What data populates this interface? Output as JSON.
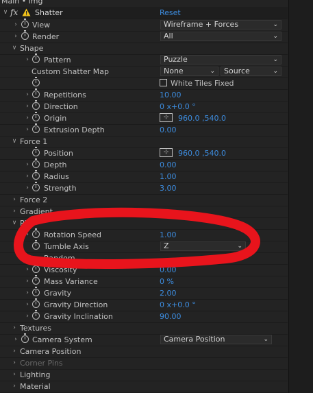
{
  "breadcrumb": "Main • img",
  "effect": {
    "name": "Shatter",
    "reset_label": "Reset",
    "fx_label": "fx"
  },
  "view": {
    "label": "View",
    "value": "Wireframe + Forces"
  },
  "render": {
    "label": "Render",
    "value": "All"
  },
  "shape": {
    "label": "Shape",
    "pattern": {
      "label": "Pattern",
      "value": "Puzzle"
    },
    "custom_map": {
      "label": "Custom Shatter Map",
      "value": "None",
      "source": "Source"
    },
    "white_tiles": {
      "label": "White Tiles Fixed",
      "checked": false
    },
    "repetitions": {
      "label": "Repetitions",
      "value": "10.00"
    },
    "direction": {
      "label": "Direction",
      "value": "0 x+0.0 °"
    },
    "origin": {
      "label": "Origin",
      "value": "960.0 ,540.0"
    },
    "extrusion_depth": {
      "label": "Extrusion Depth",
      "value": "0.00"
    }
  },
  "force1": {
    "label": "Force 1",
    "position": {
      "label": "Position",
      "value": "960.0 ,540.0"
    },
    "depth": {
      "label": "Depth",
      "value": "0.00"
    },
    "radius": {
      "label": "Radius",
      "value": "1.00"
    },
    "strength": {
      "label": "Strength",
      "value": "3.00"
    }
  },
  "force2": {
    "label": "Force 2"
  },
  "gradient": {
    "label": "Gradient"
  },
  "physics": {
    "label": "Ph",
    "rotation_speed": {
      "label": "Rotation Speed",
      "value": "1.00"
    },
    "tumble_axis": {
      "label": "Tumble Axis",
      "value": "Z"
    },
    "randomness": {
      "label": "Random"
    },
    "viscosity": {
      "label": "Viscosity",
      "value": "0.00"
    },
    "mass_variance": {
      "label": "Mass Variance",
      "value": "0 %"
    },
    "gravity": {
      "label": "Gravity",
      "value": "2.00"
    },
    "gravity_direction": {
      "label": "Gravity Direction",
      "value": "0 x+0.0 °"
    },
    "gravity_inclination": {
      "label": "Gravity Inclination",
      "value": "90.00"
    }
  },
  "textures": {
    "label": "Textures"
  },
  "camera_system": {
    "label": "Camera System",
    "value": "Camera Position"
  },
  "camera_position": {
    "label": "Camera Position"
  },
  "corner_pins": {
    "label": "Corner Pins"
  },
  "lighting": {
    "label": "Lighting"
  },
  "material": {
    "label": "Material"
  },
  "colors": {
    "background": "#232323",
    "value_blue": "#3d8de0",
    "annotation_red": "#e8141c"
  }
}
